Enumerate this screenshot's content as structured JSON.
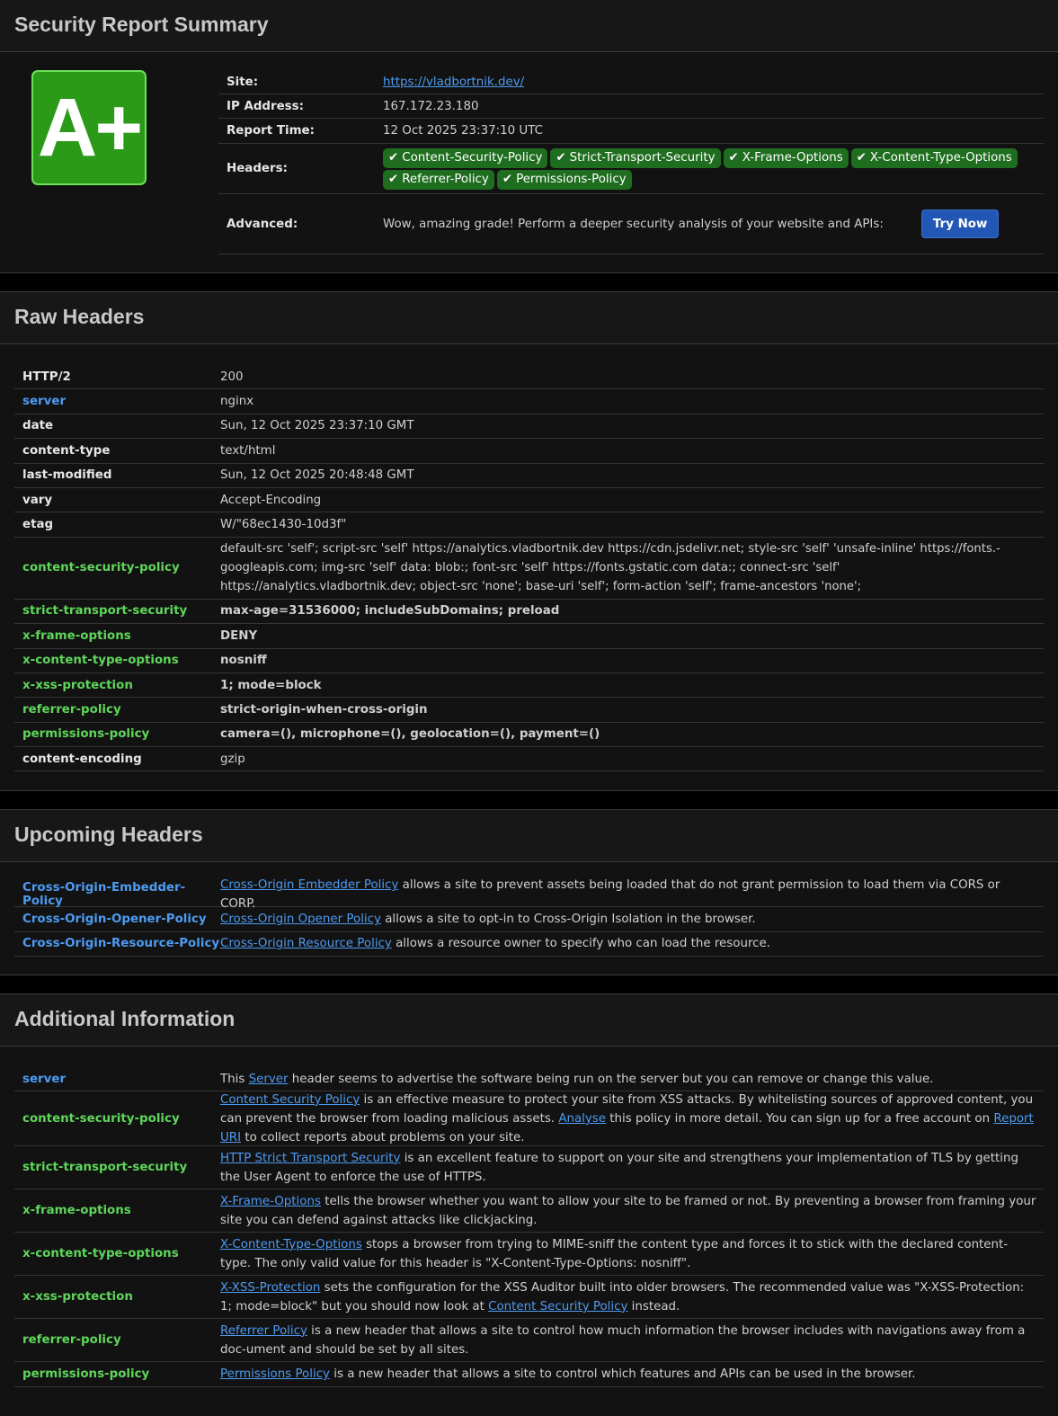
{
  "summary": {
    "title": "Security Report Summary",
    "grade": "A+",
    "site_label": "Site:",
    "site_url": "https://vladbortnik.dev/",
    "ip_label": "IP Address:",
    "ip": "167.172.23.180",
    "time_label": "Report Time:",
    "time": "12 Oct 2025 23:37:10 UTC",
    "headers_label": "Headers:",
    "headers": [
      "Content-Security-Policy",
      "Strict-Transport-Security",
      "X-Frame-Options",
      "X-Content-Type-Options",
      "Referrer-Policy",
      "Permissions-Policy"
    ],
    "advanced_label": "Advanced:",
    "advanced_text": "Wow, amazing grade! Perform a deeper security analysis of your website and APIs:",
    "try_button": "Try Now",
    "check_icon": "check-icon"
  },
  "raw": {
    "title": "Raw Headers",
    "rows": [
      {
        "key": "HTTP/2",
        "color": "white",
        "value": "200"
      },
      {
        "key": "server",
        "color": "blue",
        "value": "nginx"
      },
      {
        "key": "date",
        "color": "white",
        "value": "Sun, 12 Oct 2025 23:37:10 GMT"
      },
      {
        "key": "content-type",
        "color": "white",
        "value": "text/html"
      },
      {
        "key": "last-modified",
        "color": "white",
        "value": "Sun, 12 Oct 2025 20:48:48 GMT"
      },
      {
        "key": "vary",
        "color": "white",
        "value": "Accept-Encoding"
      },
      {
        "key": "etag",
        "color": "white",
        "value": "W/\"68ec1430-10d3f\""
      },
      {
        "key": "content-security-policy",
        "color": "green",
        "value": "default-src 'self'; script-src 'self' https://analytics.vladbortnik.dev https://cdn.jsdelivr.net; style-src 'self' 'unsafe-inline' https://fonts.-googleapis.com; img-src 'self' data: blob:; font-src 'self' https://fonts.gstatic.com data:; connect-src 'self' https://analytics.vladbortnik.dev; object-src 'none'; base-uri 'self'; form-action 'self'; frame-ancestors 'none';"
      },
      {
        "key": "strict-transport-security",
        "color": "green",
        "value": "max-age=31536000; includeSubDomains; preload"
      },
      {
        "key": "x-frame-options",
        "color": "green",
        "value": "DENY"
      },
      {
        "key": "x-content-type-options",
        "color": "green",
        "value": "nosniff"
      },
      {
        "key": "x-xss-protection",
        "color": "green",
        "value": "1; mode=block"
      },
      {
        "key": "referrer-policy",
        "color": "green",
        "value": "strict-origin-when-cross-origin"
      },
      {
        "key": "permissions-policy",
        "color": "green",
        "value": "camera=(), microphone=(), geolocation=(), payment=()"
      },
      {
        "key": "content-encoding",
        "color": "white",
        "value": "gzip"
      }
    ]
  },
  "upcoming": {
    "title": "Upcoming Headers",
    "rows": [
      {
        "key": "Cross-Origin-Embedder-Policy",
        "link": "Cross-Origin Embedder Policy",
        "text": " allows a site to prevent assets being loaded that do not grant permission to load them via CORS or CORP."
      },
      {
        "key": "Cross-Origin-Opener-Policy",
        "link": "Cross-Origin Opener Policy",
        "text": " allows a site to opt-in to Cross-Origin Isolation in the browser."
      },
      {
        "key": "Cross-Origin-Resource-Policy",
        "link": "Cross-Origin Resource Policy",
        "text": " allows a resource owner to specify who can load the resource."
      }
    ]
  },
  "additional": {
    "title": "Additional Information",
    "rows": [
      {
        "key": "server",
        "color": "blue",
        "parts": [
          {
            "t": "This "
          },
          {
            "l": "Server"
          },
          {
            "t": " header seems to advertise the software being run on the server but you can remove or change this value."
          }
        ]
      },
      {
        "key": "content-security-policy",
        "color": "green",
        "parts": [
          {
            "l": "Content Security Policy"
          },
          {
            "t": " is an effective measure to protect your site from XSS attacks. By whitelisting sources of approved content, you can prevent the browser from loading malicious assets. "
          },
          {
            "l": "Analyse"
          },
          {
            "t": " this policy in more detail. You can sign up for a free account on "
          },
          {
            "l": "Report URI"
          },
          {
            "t": " to collect reports about problems on your site."
          }
        ]
      },
      {
        "key": "strict-transport-security",
        "color": "green",
        "parts": [
          {
            "l": "HTTP Strict Transport Security"
          },
          {
            "t": " is an excellent feature to support on your site and strengthens your implementation of TLS by getting the User Agent to enforce the use of HTTPS."
          }
        ]
      },
      {
        "key": "x-frame-options",
        "color": "green",
        "parts": [
          {
            "l": "X-Frame-Options"
          },
          {
            "t": " tells the browser whether you want to allow your site to be framed or not. By preventing a browser from framing your site you can defend against attacks like clickjacking."
          }
        ]
      },
      {
        "key": "x-content-type-options",
        "color": "green",
        "parts": [
          {
            "l": "X-Content-Type-Options"
          },
          {
            "t": " stops a browser from trying to MIME-sniff the content type and forces it to stick with the declared content-type. The only valid value for this header is \"X-Content-Type-Options: nosniff\"."
          }
        ]
      },
      {
        "key": "x-xss-protection",
        "color": "green",
        "parts": [
          {
            "l": "X-XSS-Protection"
          },
          {
            "t": " sets the configuration for the XSS Auditor built into older browsers. The recommended value was \"X-XSS-Protection: 1; mode=block\" but you should now look at "
          },
          {
            "l": "Content Security Policy"
          },
          {
            "t": " instead."
          }
        ]
      },
      {
        "key": "referrer-policy",
        "color": "green",
        "parts": [
          {
            "l": "Referrer Policy"
          },
          {
            "t": " is a new header that allows a site to control how much information the browser includes with navigations away from a doc-ument and should be set by all sites."
          }
        ]
      },
      {
        "key": "permissions-policy",
        "color": "green",
        "parts": [
          {
            "l": "Permissions Policy"
          },
          {
            "t": " is a new header that allows a site to control which features and APIs can be used in the browser."
          }
        ]
      }
    ]
  }
}
